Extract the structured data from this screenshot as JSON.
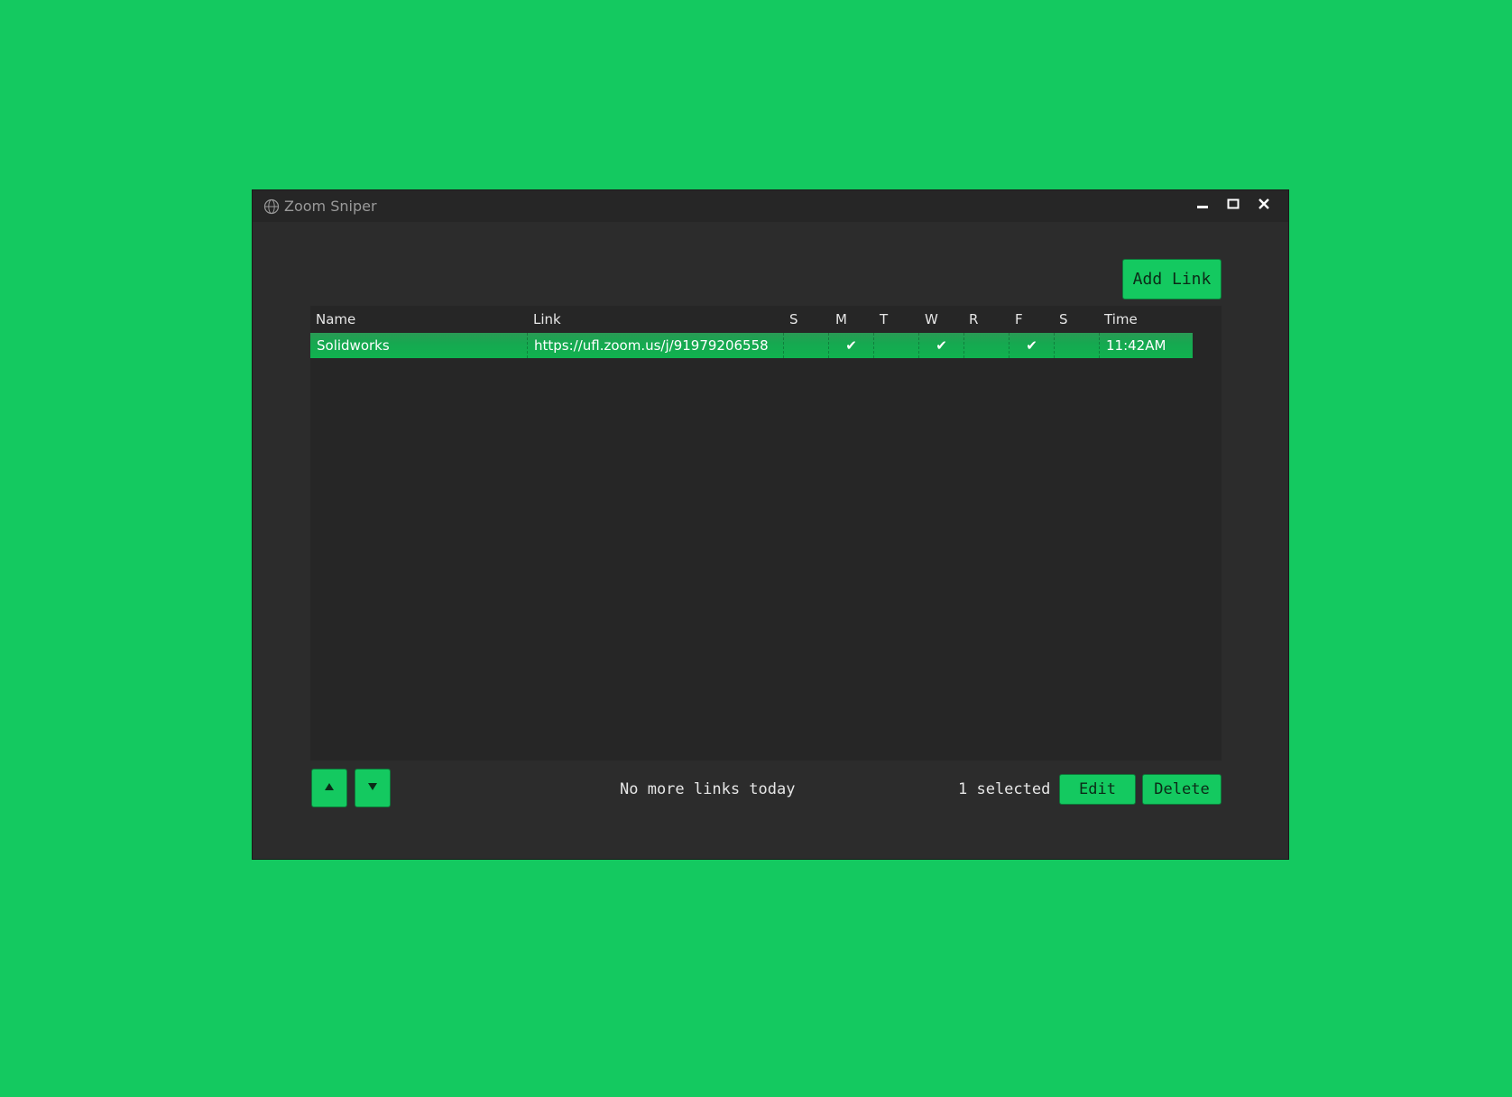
{
  "window": {
    "title": "Zoom Sniper",
    "controls": {
      "minimize_icon": "minimize-icon",
      "maximize_icon": "maximize-icon",
      "close_icon": "close-icon"
    }
  },
  "toolbar": {
    "add_link_label": "Add Link"
  },
  "table": {
    "columns": [
      "Name",
      "Link",
      "S",
      "M",
      "T",
      "W",
      "R",
      "F",
      "S",
      "Time"
    ],
    "rows": [
      {
        "name": "Solidworks",
        "link": "https://ufl.zoom.us/j/91979206558",
        "days": [
          "",
          "✔",
          "",
          "✔",
          "",
          "✔",
          ""
        ],
        "time": "11:42AM",
        "selected": true
      }
    ]
  },
  "footer": {
    "up_icon": "up-arrow-icon",
    "down_icon": "down-arrow-icon",
    "status_text": "No more links today",
    "selected_text": "1 selected",
    "edit_label": "Edit",
    "delete_label": "Delete"
  },
  "colors": {
    "accent": "#14c960",
    "window_bg": "#2c2c2c",
    "table_bg": "#262626"
  }
}
